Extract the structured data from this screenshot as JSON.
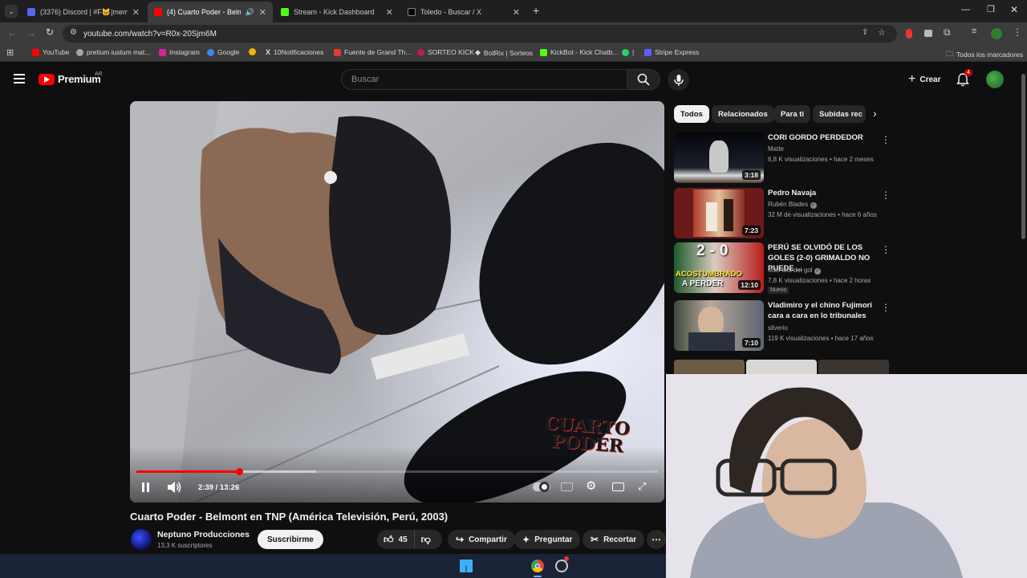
{
  "browser": {
    "tabs": [
      {
        "title": "(3376) Discord | #F🐱|memes",
        "color": "#5865f2"
      },
      {
        "title": "(4) Cuarto Poder - Belmont",
        "color": "#ff0000"
      },
      {
        "title": "Stream - Kick Dashboard",
        "color": "#53fc18"
      },
      {
        "title": "Toledo - Buscar / X",
        "color": "#000000"
      }
    ],
    "url": "youtube.com/watch?v=R0x-20Sjm6M",
    "bookmarks": [
      "YouTube",
      "pretium iustum mat...",
      "Instagram",
      "Google",
      "",
      "10Notificaciones",
      "Fuente de Grand Th...",
      "SORTEO KICK",
      "BotRix | Sorteos",
      "KickBot - Kick Chatb...",
      "|",
      "Stripe Express"
    ],
    "all_bookmarks": "Todos los marcadores"
  },
  "youtube": {
    "brand": "Premium",
    "region": "AR",
    "search_placeholder": "Buscar",
    "create_label": "Crear",
    "notification_count": "4"
  },
  "player": {
    "current_time": "2:39",
    "duration": "13:26",
    "time_display": "2:39 / 13:26",
    "progress": 0.197,
    "buffered": 0.345,
    "watermark_line1": "CUARTO",
    "watermark_line2": "PODER"
  },
  "video": {
    "title": "Cuarto Poder - Belmont en TNP (América Televisión, Perú, 2003)",
    "channel": "Neptuno Producciones",
    "subscribers": "13,3 K suscriptores",
    "subscribe_label": "Suscribirme",
    "likes": "45",
    "share_label": "Compartir",
    "ask_label": "Preguntar",
    "clip_label": "Recortar"
  },
  "chips": [
    "Todos",
    "Relacionados",
    "Para ti",
    "Subidas rec"
  ],
  "recommendations": [
    {
      "title": "CORI GORDO PERDEDOR",
      "channel": "Matte",
      "stats": "6,8 K visualizaciones • hace 2 meses",
      "duration": "3:18",
      "verified": false,
      "badge": ""
    },
    {
      "title": "Pedro Navaja",
      "channel": "Rubén Blades",
      "stats": "32 M de visualizaciones • hace 6 años",
      "duration": "7:23",
      "verified": true,
      "badge": ""
    },
    {
      "title": "PERÚ SE OLVIDÓ DE LOS GOLES (2-0) GRIMALDO NO PUEDE ...",
      "channel": "Más allá del gol",
      "stats": "7,8 K visualizaciones • hace 2 horas",
      "duration": "12:10",
      "verified": true,
      "badge": "Nuevo",
      "thumb_text1": "2-0",
      "thumb_text2": "ACOSTUMBRADO",
      "thumb_text3": "A PERDER"
    },
    {
      "title": "Vladimiro y el chino Fujimori cara  a cara en lo tribunales",
      "channel": "silverio",
      "stats": "119 K visualizaciones • hace 17 años",
      "duration": "7:10",
      "verified": false,
      "badge": ""
    }
  ],
  "colors": {
    "brand_red": "#ff0000",
    "background": "#0f0f0f",
    "chip_bg": "#272727",
    "taskbar": "#1b2338"
  }
}
